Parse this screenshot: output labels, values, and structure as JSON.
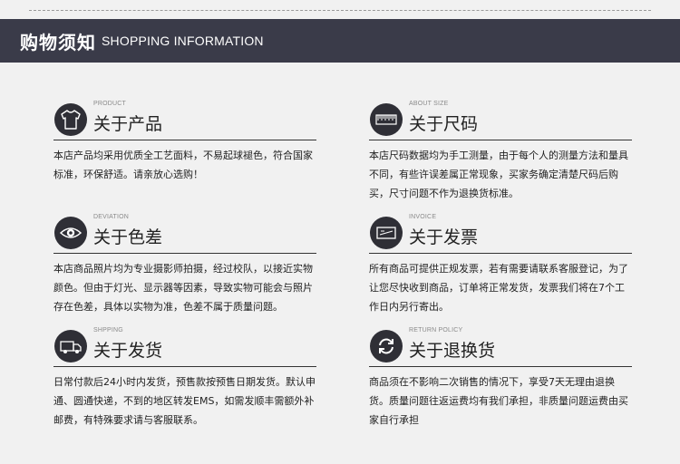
{
  "header": {
    "title_cn": "购物须知",
    "title_en": "SHOPPING INFORMATION"
  },
  "sections": [
    {
      "en": "PRODUCT",
      "title": "关于产品",
      "icon": "shirt-icon",
      "body": "本店产品均采用优质全工艺面料，不易起球褪色，符合国家标准，环保舒适。请亲放心选购！"
    },
    {
      "en": "ABOUT SIZE",
      "title": "关于尺码",
      "icon": "ruler-icon",
      "body": "本店尺码数据均为手工测量，由于每个人的测量方法和量具不同，有些许误差属正常现象，买家务确定清楚尺码后购买，尺寸问题不作为退换货标准。"
    },
    {
      "en": "DEVIATION",
      "title": "关于色差",
      "icon": "eye-icon",
      "body": "本店商品照片均为专业摄影师拍摄，经过校队，以接近实物颜色。但由于灯光、显示器等因素，导致实物可能会与照片存在色差，具体以实物为准，色差不属于质量问题。"
    },
    {
      "en": "INVOICE",
      "title": "关于发票",
      "icon": "invoice-icon",
      "body": "所有商品可提供正规发票，若有需要请联系客服登记，为了让您尽快收到商品，订单将正常发货，发票我们将在7个工作日内另行寄出。"
    },
    {
      "en": "SHPPING",
      "title": "关于发货",
      "icon": "truck-icon",
      "body": "日常付款后24小时内发货，预售款按预售日期发货。默认申通、圆通快递，不到的地区转发EMS，如需发顺丰需额外补邮费，有特殊要求请与客服联系。"
    },
    {
      "en": "RETURN POLICY",
      "title": "关于退换货",
      "icon": "return-icon",
      "body": "商品须在不影响二次销售的情况下，享受7天无理由退换货。质量问题往返运费均有我们承担，非质量问题运费由买家自行承担"
    }
  ]
}
